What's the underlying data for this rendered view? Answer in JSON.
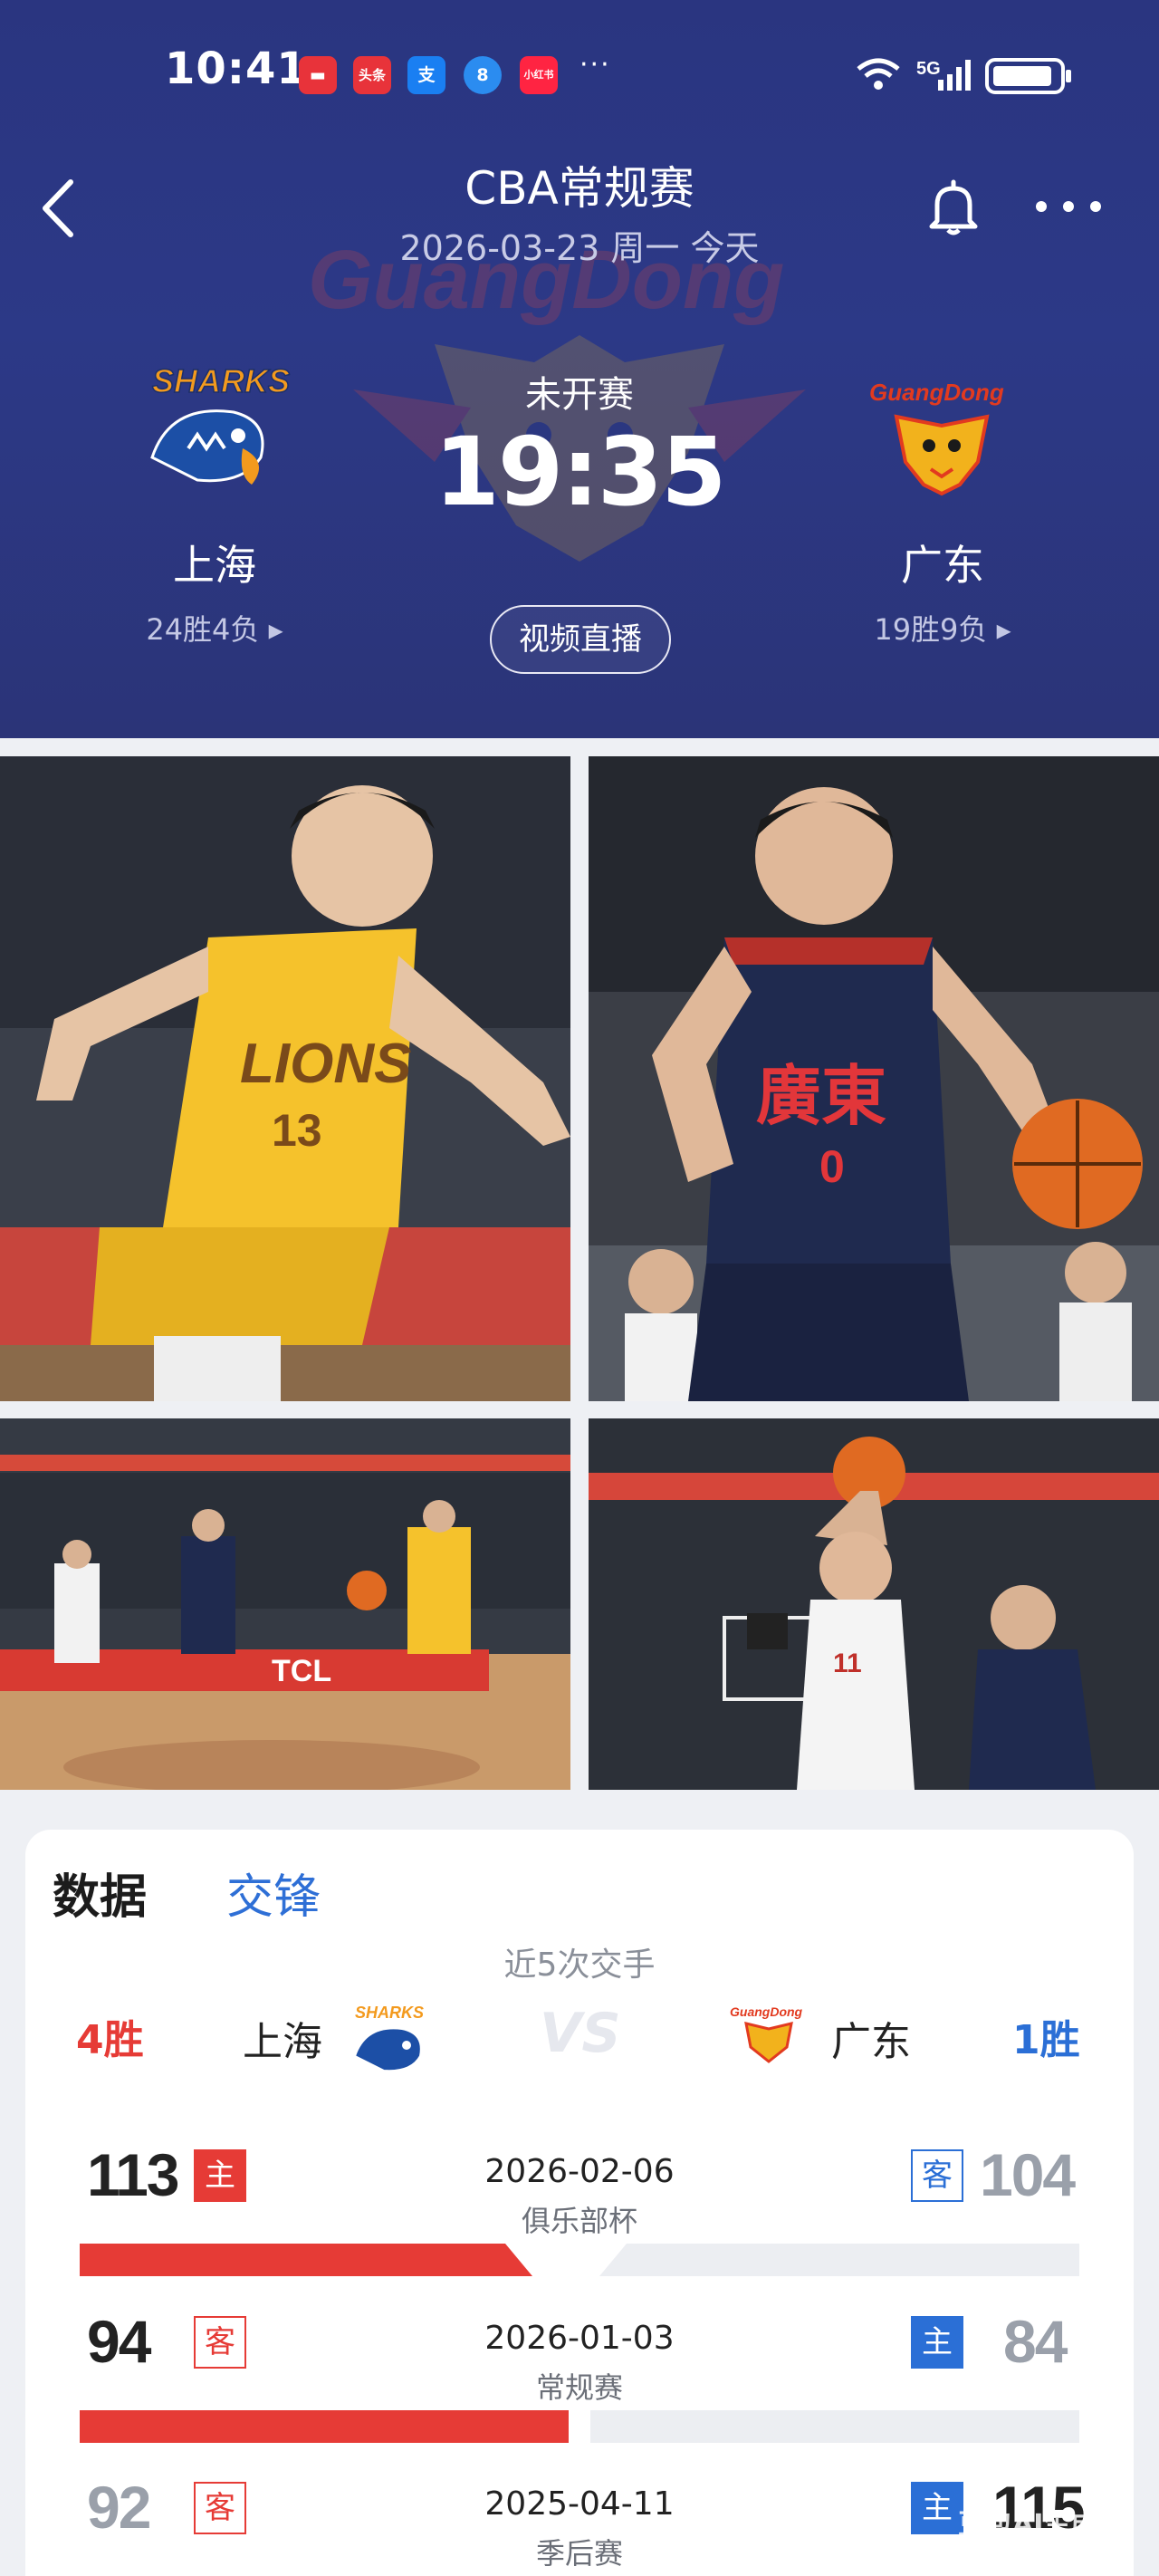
{
  "status_bar": {
    "time": "10:41",
    "notifications": [
      {
        "text": "▬",
        "color": "#e8333a"
      },
      {
        "text": "头条",
        "color": "#e8333a"
      },
      {
        "text": "支",
        "color": "#1a7ff2"
      },
      {
        "text": "8",
        "color": "#2b8cf0"
      },
      {
        "text": "小红书",
        "color": "#ff2442"
      }
    ],
    "more": "···",
    "network": "5G"
  },
  "nav": {
    "title": "CBA常规赛",
    "subtitle": "2026-03-23 周一 今天"
  },
  "match": {
    "status": "未开赛",
    "time": "19:35",
    "video_button": "视频直播",
    "home": {
      "name": "上海",
      "record": "24胜4负 ▸",
      "logo_text": "SHARKS",
      "color": "#1c4fa6"
    },
    "away": {
      "name": "广东",
      "record": "19胜9负 ▸",
      "logo_text": "GuangDong",
      "color": "#e23a1f"
    }
  },
  "tabs": {
    "data": "数据",
    "h2h": "交锋"
  },
  "h2h": {
    "title": "近5次交手",
    "home_wins": "4胜",
    "away_wins": "1胜",
    "home_team": "上海",
    "away_team": "广东",
    "vs": "VS",
    "games": [
      {
        "home_score": "113",
        "home_tag": "主",
        "date": "2026-02-06",
        "type": "俱乐部杯",
        "away_tag": "客",
        "away_score": "104",
        "winner": "home"
      },
      {
        "home_score": "94",
        "home_tag": "客",
        "date": "2026-01-03",
        "type": "常规赛",
        "away_tag": "主",
        "away_score": "84",
        "winner": "home"
      },
      {
        "home_score": "92",
        "home_tag": "客",
        "date": "2025-04-11",
        "type": "季后赛",
        "away_tag": "主",
        "away_score": "115",
        "winner": "away"
      }
    ]
  },
  "colors": {
    "red": "#e63b36",
    "blue": "#2b6fd6",
    "loser_gray": "#9aa0aa"
  },
  "watermark": "豆包AI生成"
}
